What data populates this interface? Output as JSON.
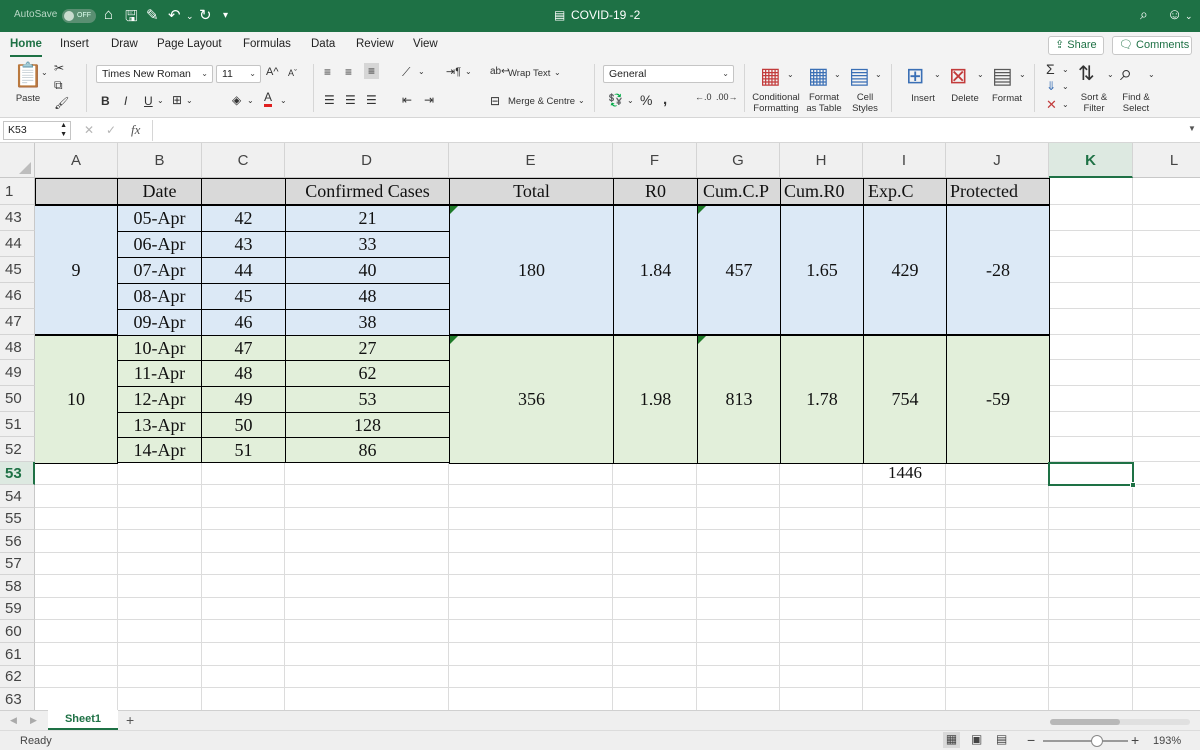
{
  "titlebar": {
    "autosave_label": "AutoSave",
    "autosave_state": "OFF",
    "document_title": "COVID-19 -2",
    "accent_color": "#1e7145"
  },
  "menu": {
    "tabs": [
      "Home",
      "Insert",
      "Draw",
      "Page Layout",
      "Formulas",
      "Data",
      "Review",
      "View"
    ],
    "active_tab": "Home",
    "share_label": "Share",
    "comments_label": "Comments"
  },
  "ribbon": {
    "paste_label": "Paste",
    "font_name": "Times New Roman",
    "font_size": "11",
    "wrap_text_label": "Wrap Text",
    "merge_centre_label": "Merge & Centre",
    "number_format": "General",
    "conditional_formatting_label": "Conditional\nFormatting",
    "format_as_table_label": "Format\nas Table",
    "cell_styles_label": "Cell\nStyles",
    "insert_label": "Insert",
    "delete_label": "Delete",
    "format_label": "Format",
    "sort_filter_label": "Sort &\nFilter",
    "find_select_label": "Find &\nSelect"
  },
  "formula_bar": {
    "name_box": "K53",
    "fx_label": "fx",
    "content": ""
  },
  "columns": [
    "A",
    "B",
    "C",
    "D",
    "E",
    "F",
    "G",
    "H",
    "I",
    "J",
    "K",
    "L"
  ],
  "selected_column": "K",
  "row_numbers": [
    "1",
    "43",
    "44",
    "45",
    "46",
    "47",
    "48",
    "49",
    "50",
    "51",
    "52",
    "53",
    "54",
    "55",
    "56",
    "57",
    "58",
    "59",
    "60",
    "61",
    "62",
    "63"
  ],
  "selected_row": "53",
  "table_headers": {
    "b": "Date",
    "d": "Confirmed Cases",
    "e": "Total",
    "f": "R0",
    "g": "Cum.C.P",
    "h": "Cum.R0",
    "i": "Exp.C",
    "j": "Protected"
  },
  "days": [
    {
      "date": "05-Apr",
      "c": "42",
      "d": "21"
    },
    {
      "date": "06-Apr",
      "c": "43",
      "d": "33"
    },
    {
      "date": "07-Apr",
      "c": "44",
      "d": "40"
    },
    {
      "date": "08-Apr",
      "c": "45",
      "d": "48"
    },
    {
      "date": "09-Apr",
      "c": "46",
      "d": "38"
    },
    {
      "date": "10-Apr",
      "c": "47",
      "d": "27"
    },
    {
      "date": "11-Apr",
      "c": "48",
      "d": "62"
    },
    {
      "date": "12-Apr",
      "c": "49",
      "d": "53"
    },
    {
      "date": "13-Apr",
      "c": "50",
      "d": "128"
    },
    {
      "date": "14-Apr",
      "c": "51",
      "d": "86"
    }
  ],
  "blocks": [
    {
      "week": "9",
      "total": "180",
      "r0": "1.84",
      "cum_cp": "457",
      "cum_r0": "1.65",
      "exp_c": "429",
      "protected": "-28",
      "fill": "#dce9f6"
    },
    {
      "week": "10",
      "total": "356",
      "r0": "1.98",
      "cum_cp": "813",
      "cum_r0": "1.78",
      "exp_c": "754",
      "protected": "-59",
      "fill": "#e2efda"
    }
  ],
  "row53_i": "1446",
  "sheet_tab": "Sheet1",
  "status": {
    "ready": "Ready",
    "zoom": "193%"
  }
}
